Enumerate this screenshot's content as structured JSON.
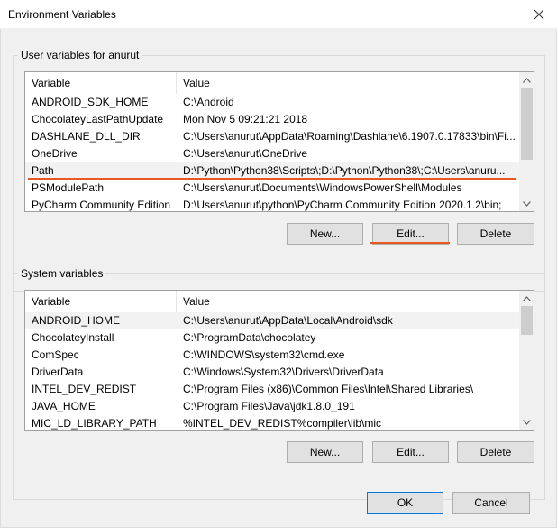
{
  "window": {
    "title": "Environment Variables"
  },
  "user_group": {
    "label": "User variables for anurut",
    "columns": [
      "Variable",
      "Value"
    ],
    "rows": [
      {
        "variable": "ANDROID_SDK_HOME",
        "value": "C:\\Android"
      },
      {
        "variable": "ChocolateyLastPathUpdate",
        "value": "Mon Nov  5 09:21:21 2018"
      },
      {
        "variable": "DASHLANE_DLL_DIR",
        "value": "C:\\Users\\anurut\\AppData\\Roaming\\Dashlane\\6.1907.0.17833\\bin\\Fi..."
      },
      {
        "variable": "OneDrive",
        "value": "C:\\Users\\anurut\\OneDrive"
      },
      {
        "variable": "Path",
        "value": "D:\\Python\\Python38\\Scripts\\;D:\\Python\\Python38\\;C:\\Users\\anuru..."
      },
      {
        "variable": "PSModulePath",
        "value": "C:\\Users\\anurut\\Documents\\WindowsPowerShell\\Modules"
      },
      {
        "variable": "PyCharm Community Edition",
        "value": "D:\\Users\\anurut\\python\\PyCharm Community Edition 2020.1.2\\bin;"
      }
    ],
    "buttons": {
      "new": "New...",
      "edit": "Edit...",
      "delete": "Delete"
    }
  },
  "system_group": {
    "label": "System variables",
    "columns": [
      "Variable",
      "Value"
    ],
    "rows": [
      {
        "variable": "ANDROID_HOME",
        "value": "C:\\Users\\anurut\\AppData\\Local\\Android\\sdk"
      },
      {
        "variable": "ChocolateyInstall",
        "value": "C:\\ProgramData\\chocolatey"
      },
      {
        "variable": "ComSpec",
        "value": "C:\\WINDOWS\\system32\\cmd.exe"
      },
      {
        "variable": "DriverData",
        "value": "C:\\Windows\\System32\\Drivers\\DriverData"
      },
      {
        "variable": "INTEL_DEV_REDIST",
        "value": "C:\\Program Files (x86)\\Common Files\\Intel\\Shared Libraries\\"
      },
      {
        "variable": "JAVA_HOME",
        "value": "C:\\Program Files\\Java\\jdk1.8.0_191"
      },
      {
        "variable": "MIC_LD_LIBRARY_PATH",
        "value": "%INTEL_DEV_REDIST%compiler\\lib\\mic"
      }
    ],
    "buttons": {
      "new": "New...",
      "edit": "Edit...",
      "delete": "Delete"
    }
  },
  "footer": {
    "ok": "OK",
    "cancel": "Cancel"
  },
  "icons": {
    "close": "close-icon",
    "scroll_up": "arrow-up-icon",
    "scroll_down": "arrow-down-icon"
  },
  "colors": {
    "annotation": "#e8581f",
    "selected_row": "#f2f2f2"
  }
}
